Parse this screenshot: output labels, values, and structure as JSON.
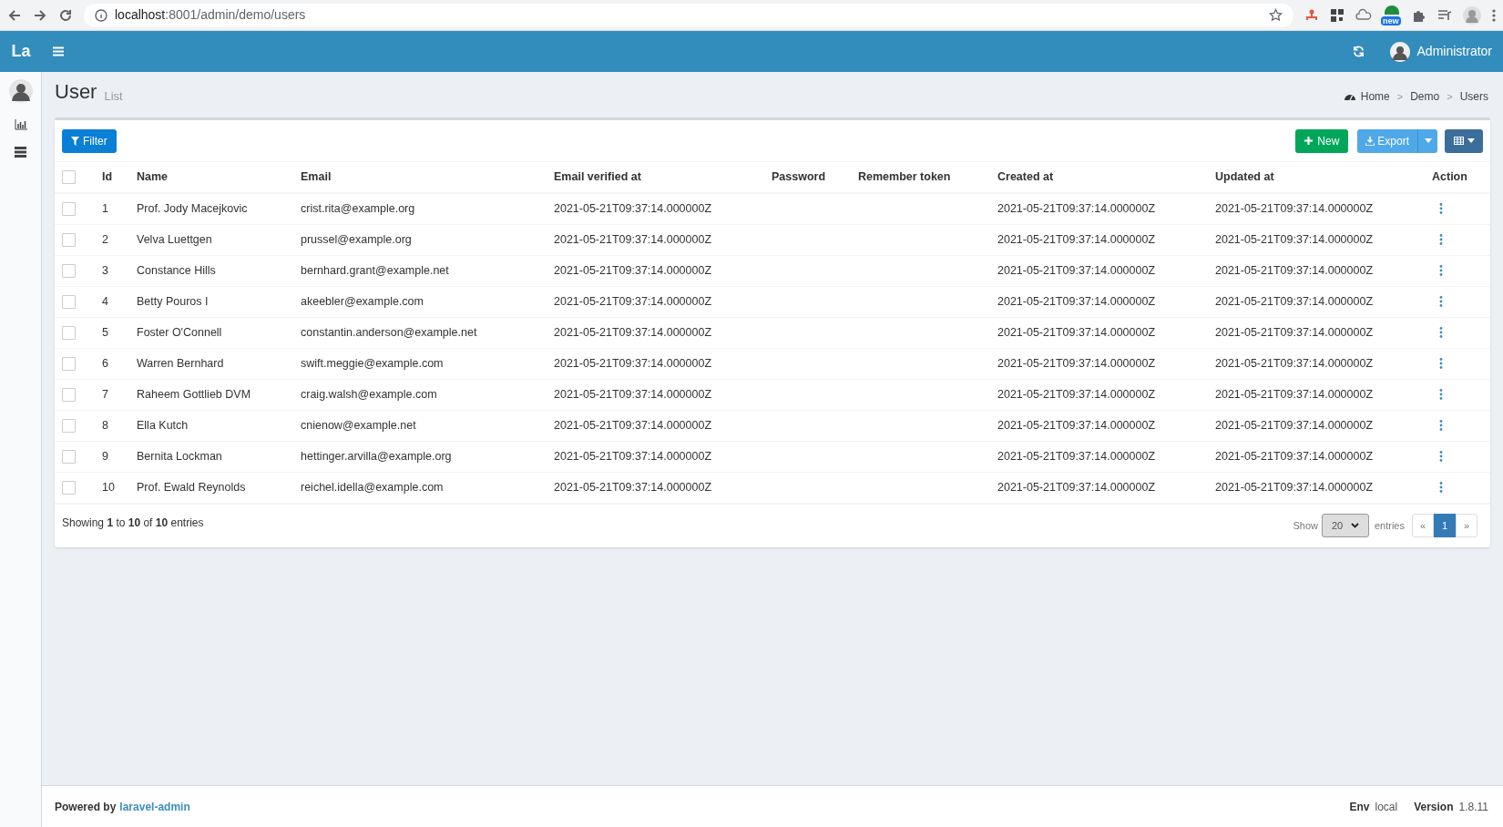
{
  "browser": {
    "url_host": "localhost",
    "url_path": ":8001/admin/demo/users",
    "extension_badge": "new"
  },
  "header": {
    "logo": "La",
    "user_name": "Administrator"
  },
  "page": {
    "title": "User",
    "subtitle": "List",
    "breadcrumbs": [
      "Home",
      "Demo",
      "Users"
    ],
    "breadcrumb_separator": ">"
  },
  "toolbar": {
    "filter": "Filter",
    "new": "New",
    "export": "Export"
  },
  "table": {
    "columns": [
      "Id",
      "Name",
      "Email",
      "Email verified at",
      "Password",
      "Remember token",
      "Created at",
      "Updated at",
      "Action"
    ],
    "header_checked": false,
    "rows": [
      {
        "checked": false,
        "id": "1",
        "name": "Prof. Jody Macejkovic",
        "email": "crist.rita@example.org",
        "email_verified_at": "2021-05-21T09:37:14.000000Z",
        "created_at": "2021-05-21T09:37:14.000000Z",
        "updated_at": "2021-05-21T09:37:14.000000Z"
      },
      {
        "checked": false,
        "id": "2",
        "name": "Velva Luettgen",
        "email": "prussel@example.org",
        "email_verified_at": "2021-05-21T09:37:14.000000Z",
        "created_at": "2021-05-21T09:37:14.000000Z",
        "updated_at": "2021-05-21T09:37:14.000000Z"
      },
      {
        "checked": false,
        "id": "3",
        "name": "Constance Hills",
        "email": "bernhard.grant@example.net",
        "email_verified_at": "2021-05-21T09:37:14.000000Z",
        "created_at": "2021-05-21T09:37:14.000000Z",
        "updated_at": "2021-05-21T09:37:14.000000Z"
      },
      {
        "checked": false,
        "id": "4",
        "name": "Betty Pouros I",
        "email": "akeebler@example.com",
        "email_verified_at": "2021-05-21T09:37:14.000000Z",
        "created_at": "2021-05-21T09:37:14.000000Z",
        "updated_at": "2021-05-21T09:37:14.000000Z"
      },
      {
        "checked": false,
        "id": "5",
        "name": "Foster O'Connell",
        "email": "constantin.anderson@example.net",
        "email_verified_at": "2021-05-21T09:37:14.000000Z",
        "created_at": "2021-05-21T09:37:14.000000Z",
        "updated_at": "2021-05-21T09:37:14.000000Z"
      },
      {
        "checked": false,
        "id": "6",
        "name": "Warren Bernhard",
        "email": "swift.meggie@example.com",
        "email_verified_at": "2021-05-21T09:37:14.000000Z",
        "created_at": "2021-05-21T09:37:14.000000Z",
        "updated_at": "2021-05-21T09:37:14.000000Z"
      },
      {
        "checked": false,
        "id": "7",
        "name": "Raheem Gottlieb DVM",
        "email": "craig.walsh@example.com",
        "email_verified_at": "2021-05-21T09:37:14.000000Z",
        "created_at": "2021-05-21T09:37:14.000000Z",
        "updated_at": "2021-05-21T09:37:14.000000Z"
      },
      {
        "checked": false,
        "id": "8",
        "name": "Ella Kutch",
        "email": "cnienow@example.net",
        "email_verified_at": "2021-05-21T09:37:14.000000Z",
        "created_at": "2021-05-21T09:37:14.000000Z",
        "updated_at": "2021-05-21T09:37:14.000000Z"
      },
      {
        "checked": false,
        "id": "9",
        "name": "Bernita Lockman",
        "email": "hettinger.arvilla@example.org",
        "email_verified_at": "2021-05-21T09:37:14.000000Z",
        "created_at": "2021-05-21T09:37:14.000000Z",
        "updated_at": "2021-05-21T09:37:14.000000Z"
      },
      {
        "checked": false,
        "id": "10",
        "name": "Prof. Ewald Reynolds",
        "email": "reichel.idella@example.com",
        "email_verified_at": "2021-05-21T09:37:14.000000Z",
        "created_at": "2021-05-21T09:37:14.000000Z",
        "updated_at": "2021-05-21T09:37:14.000000Z"
      }
    ]
  },
  "summary": "Showing **1** to **10** of **10** entries",
  "pagination": {
    "show_label": "Show",
    "per_page": "20",
    "entries_label": "entries",
    "pages": [
      {
        "label": "«",
        "selected": false
      },
      {
        "label": "1",
        "selected": true
      },
      {
        "label": "»",
        "selected": false
      }
    ]
  },
  "footer": {
    "powered_by": "Powered by",
    "link": "laravel-admin",
    "env_label": "Env",
    "env": "local",
    "version_label": "Version",
    "version": "1.8.11"
  }
}
